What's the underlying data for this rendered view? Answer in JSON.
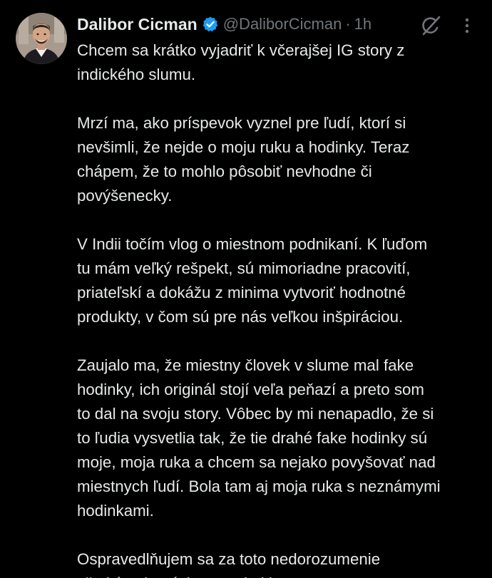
{
  "author": {
    "display_name": "Dalibor Cicman",
    "handle": "@DaliborCicman",
    "separator": "·",
    "time": "1h",
    "verified": true,
    "avatar_icon": "profile-photo"
  },
  "icons": {
    "verified": "verified-badge-icon",
    "grok": "grok-icon",
    "more": "more-options-icon",
    "verified_color": "#1d9bf0",
    "secondary_text_color": "#71767b"
  },
  "tweet": {
    "paragraphs": [
      "Chcem sa krátko vyjadriť k včerajšej IG story z\nindického slumu.",
      "Mrzí ma, ako príspevok vyznel pre ľudí, ktorí si\nnevšimli, že nejde o moju ruku a hodinky. Teraz\nchápem, že to mohlo pôsobiť nevhodne či\npovýšenecky.",
      "V Indii točím vlog o miestnom podnikaní. K ľuďom\ntu mám veľký rešpekt, sú mimoriadne pracovití,\npriateľskí a dokážu z minima vytvoriť hodnotné\nprodukty, v čom sú pre nás veľkou inšpiráciou.",
      "Zaujalo ma, že miestny človek v slume mal fake\nhodinky, ich originál stojí veľa peňazí a preto som\nto dal na svoju story. Vôbec by mi nenapadlo, že si\nto ľudia vysvetlia tak, že tie drahé fake hodinky sú\nmoje, moja ruka a chcem sa nejako povyšovať nad\nmiestnych ľudí. Bola tam aj moja ruka s neznámymi\nhodinkami.",
      "Ospravedlňujem sa za toto nedorozumenie\nvšetkým, ktorých sa to dotklo."
    ]
  }
}
